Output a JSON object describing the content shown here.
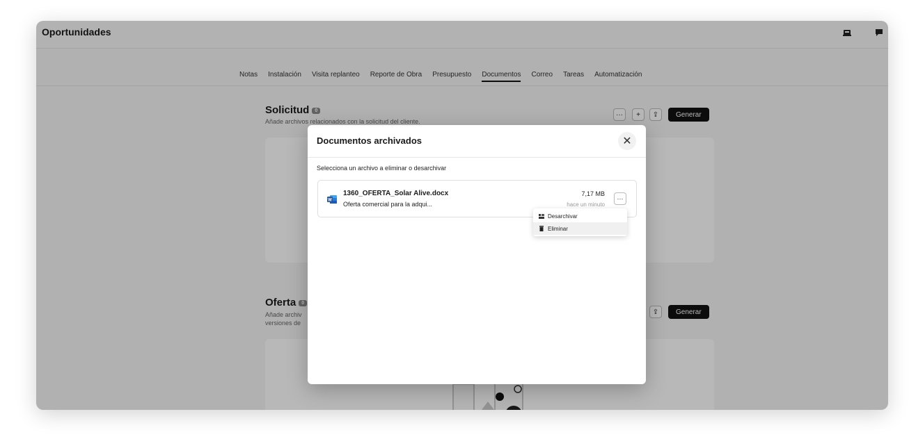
{
  "app": {
    "title": "Oportunidades",
    "icons": [
      "inbox-icon",
      "chat-icon"
    ]
  },
  "tabs": [
    {
      "label": "Notas",
      "active": false
    },
    {
      "label": "Instalación",
      "active": false
    },
    {
      "label": "Visita replanteo",
      "active": false
    },
    {
      "label": "Reporte de Obra",
      "active": false
    },
    {
      "label": "Presupuesto",
      "active": false
    },
    {
      "label": "Documentos",
      "active": true
    },
    {
      "label": "Correo",
      "active": false
    },
    {
      "label": "Tareas",
      "active": false
    },
    {
      "label": "Automatización",
      "active": false
    }
  ],
  "solicitud": {
    "title": "Solicitud",
    "badge": "0",
    "subtitle": "Añade archivos relacionados con la solicitud del cliente.",
    "more_label": "···",
    "add_label": "+",
    "upload_label": "⇪",
    "generate_label": "Generar"
  },
  "oferta": {
    "title": "Oferta",
    "badge": "0",
    "subtitle_line1": "Añade archiv",
    "subtitle_line2": "versiones de",
    "upload_label": "⇪",
    "generate_label": "Generar"
  },
  "modal": {
    "title": "Documentos archivados",
    "close_label": "✕",
    "instruction": "Selecciona un archivo a eliminar o desarchivar",
    "file": {
      "name": "1360_OFERTA_Solar Alive.docx",
      "description": "Oferta comercial para la adqui...",
      "size": "7,17 MB",
      "time": "hace un minuto",
      "more_label": "···",
      "icon": "word-icon"
    },
    "menu": {
      "items": [
        {
          "label": "Desarchivar",
          "icon": "unarchive-icon"
        },
        {
          "label": "Eliminar",
          "icon": "trash-icon"
        }
      ]
    }
  },
  "colors": {
    "accent": "#111111",
    "word_blue": "#2b579a"
  }
}
